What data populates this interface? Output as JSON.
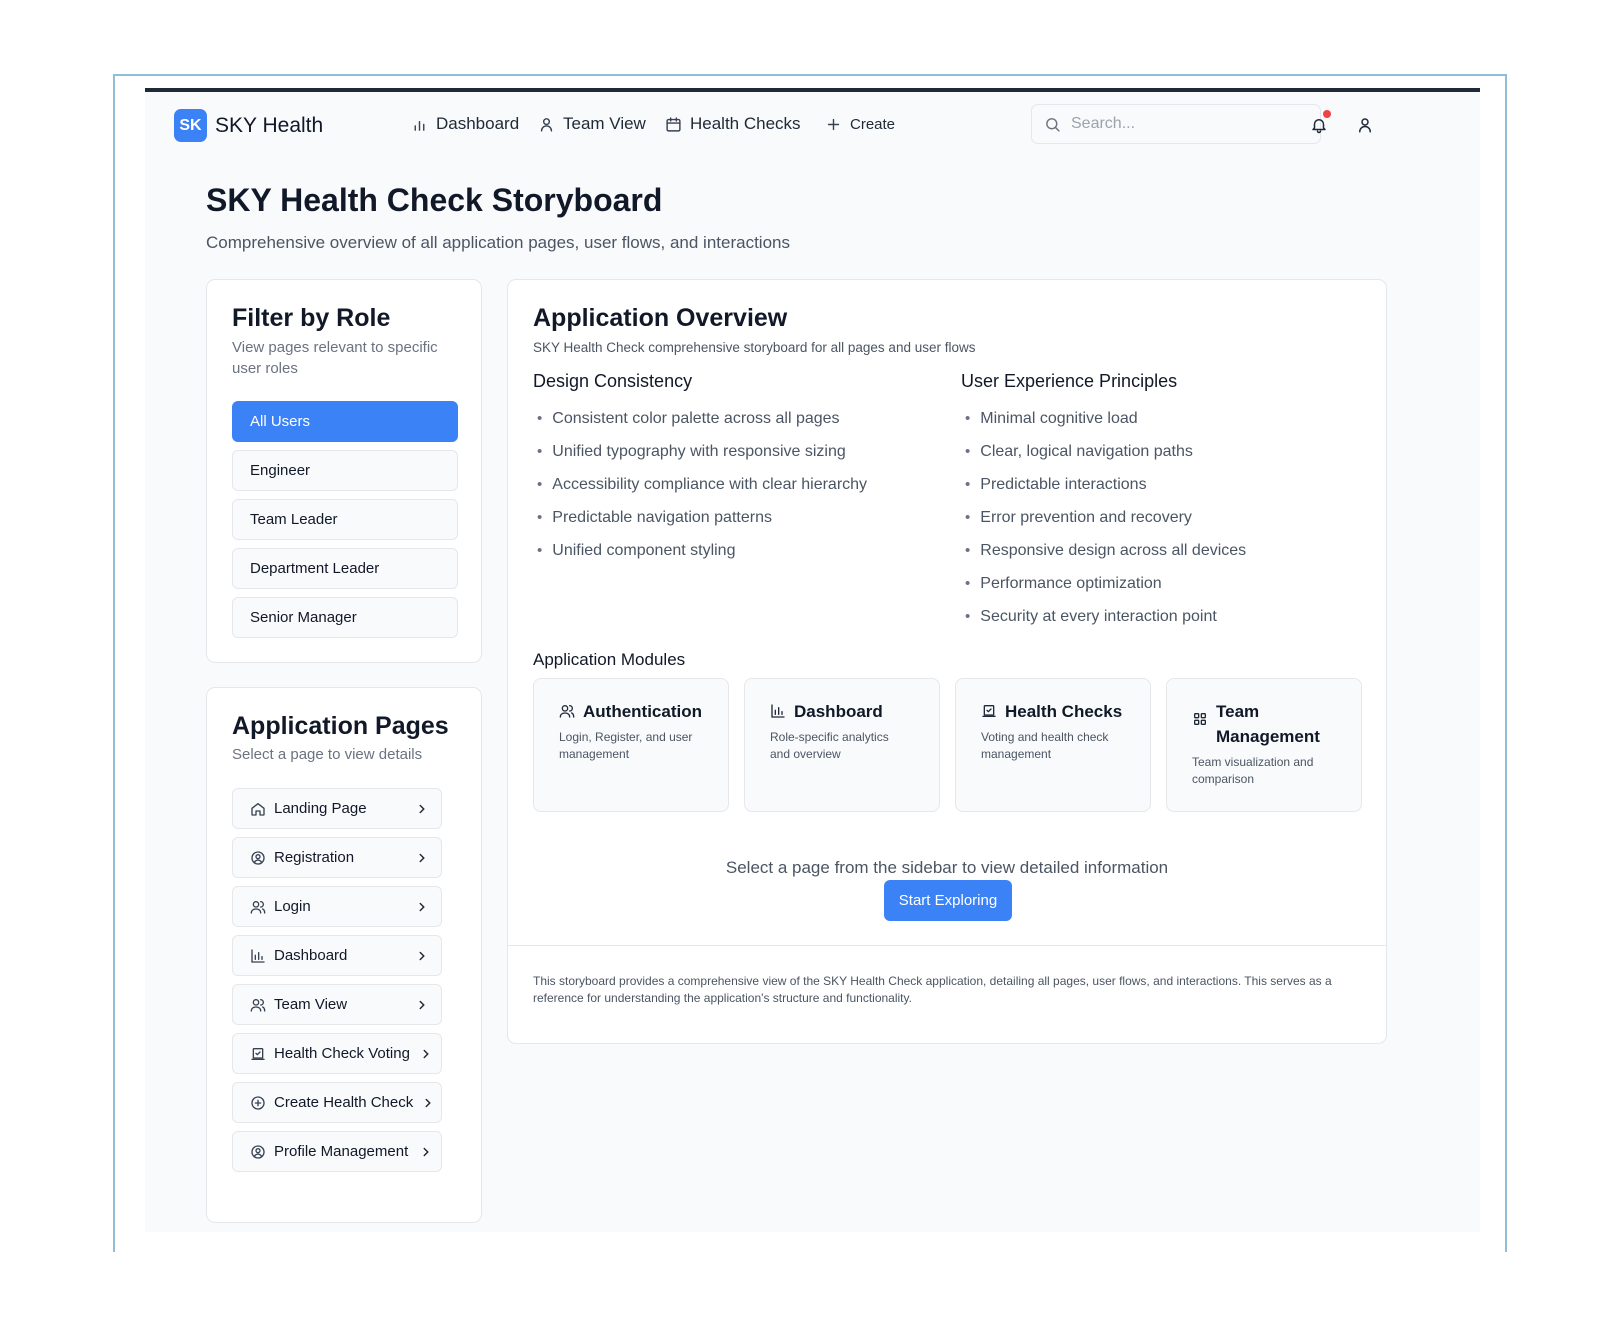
{
  "app": {
    "logo_badge": "SK",
    "logo_text": "SKY Health"
  },
  "nav": {
    "links": [
      {
        "label": "Dashboard",
        "icon": "bar-chart-icon"
      },
      {
        "label": "Team View",
        "icon": "user-icon"
      },
      {
        "label": "Health Checks",
        "icon": "calendar-icon"
      },
      {
        "label": "Create",
        "icon": "plus-icon"
      }
    ],
    "search_placeholder": "Search...",
    "has_notification": true
  },
  "header": {
    "title": "SKY Health Check Storyboard",
    "subtitle": "Comprehensive overview of all application pages, user flows, and interactions"
  },
  "filter": {
    "title": "Filter by Role",
    "description": "View pages relevant to specific user roles",
    "roles": [
      {
        "label": "All Users",
        "active": true
      },
      {
        "label": "Engineer",
        "active": false
      },
      {
        "label": "Team Leader",
        "active": false
      },
      {
        "label": "Department Leader",
        "active": false
      },
      {
        "label": "Senior Manager",
        "active": false
      }
    ]
  },
  "pages": {
    "title": "Application Pages",
    "description": "Select a page to view details",
    "items": [
      {
        "label": "Landing Page",
        "icon": "home-icon"
      },
      {
        "label": "Registration",
        "icon": "user-circle-icon"
      },
      {
        "label": "Login",
        "icon": "users-icon"
      },
      {
        "label": "Dashboard",
        "icon": "bar-chart-icon"
      },
      {
        "label": "Team View",
        "icon": "users-icon"
      },
      {
        "label": "Health Check Voting",
        "icon": "vote-icon"
      },
      {
        "label": "Create Health Check",
        "icon": "plus-circle-icon"
      },
      {
        "label": "Profile Management",
        "icon": "user-circle-icon"
      }
    ]
  },
  "overview": {
    "title": "Application Overview",
    "subtitle": "SKY Health Check comprehensive storyboard for all pages and user flows",
    "design": {
      "title": "Design Consistency",
      "items": [
        "Consistent color palette across all pages",
        "Unified typography with responsive sizing",
        "Accessibility compliance with clear hierarchy",
        "Predictable navigation patterns",
        "Unified component styling"
      ]
    },
    "ux": {
      "title": "User Experience Principles",
      "items": [
        "Minimal cognitive load",
        "Clear, logical navigation paths",
        "Predictable interactions",
        "Error prevention and recovery",
        "Responsive design across all devices",
        "Performance optimization",
        "Security at every interaction point"
      ]
    },
    "modules_title": "Application Modules",
    "modules": [
      {
        "title": "Authentication",
        "description": "Login, Register, and user management",
        "icon": "users-icon"
      },
      {
        "title": "Dashboard",
        "description": "Role-specific analytics and overview",
        "icon": "bar-chart-icon"
      },
      {
        "title": "Health Checks",
        "description": "Voting and health check management",
        "icon": "vote-icon"
      },
      {
        "title": "Team Management",
        "description": "Team visualization and comparison",
        "icon": "grid-icon"
      }
    ],
    "select_message": "Select a page from the sidebar to view detailed information",
    "explore_button": "Start Exploring",
    "footer": "This storyboard provides a comprehensive view of the SKY Health Check application, detailing all pages, user flows, and interactions. This serves as a reference for understanding the application's structure and functionality."
  },
  "colors": {
    "accent": "#3b82f6",
    "notification": "#ef4444",
    "background": "#f8fafc"
  }
}
